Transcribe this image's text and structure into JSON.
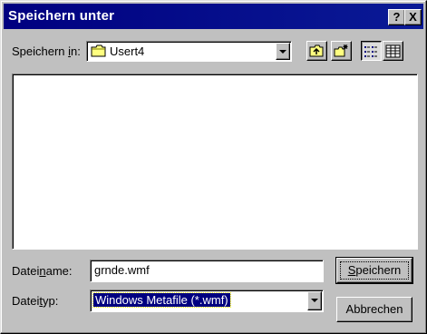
{
  "title": "Speichern unter",
  "title_help": "?",
  "title_close": "X",
  "save_in": {
    "label_pre": "Speichern ",
    "label_key": "i",
    "label_post": "n:",
    "value": "Usert4"
  },
  "filename": {
    "label_pre": "Datei",
    "label_key": "n",
    "label_post": "ame:",
    "value": "grnde.wmf"
  },
  "filetype": {
    "label_pre": "Datei",
    "label_key": "t",
    "label_post": "yp:",
    "value": "Windows Metafile (*.wmf)"
  },
  "buttons": {
    "save_key": "S",
    "save_rest": "peichern",
    "cancel": "Abbrechen"
  },
  "tools": [
    "up-folder-icon",
    "new-folder-icon",
    "list-view-icon",
    "details-view-icon"
  ]
}
